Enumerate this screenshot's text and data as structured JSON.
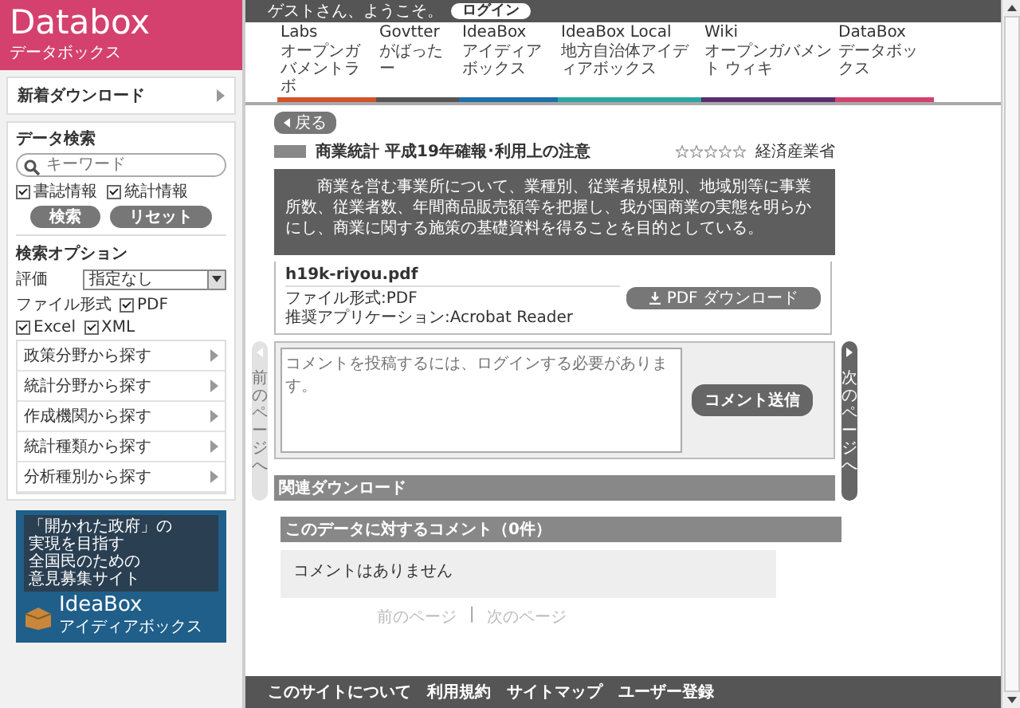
{
  "sidebar": {
    "logo": {
      "title": "Databox",
      "subtitle": "データボックス"
    },
    "new_downloads": "新着ダウンロード",
    "search": {
      "heading": "データ検索",
      "placeholder": "キーワード",
      "filters": [
        {
          "label": "書誌情報",
          "checked": true
        },
        {
          "label": "統計情報",
          "checked": true
        }
      ],
      "buttons": [
        "検索",
        "リセット"
      ]
    },
    "options": {
      "heading": "検索オプション",
      "rating_label": "評価",
      "rating_value": "指定なし",
      "format_label": "ファイル形式",
      "formats": [
        {
          "label": "PDF",
          "checked": true
        },
        {
          "label": "Excel",
          "checked": true
        },
        {
          "label": "XML",
          "checked": true
        }
      ]
    },
    "browse": [
      "政策分野から探す",
      "統計分野から探す",
      "作成機関から探す",
      "統計種類から探す",
      "分析種別から探す"
    ],
    "banner": {
      "lines": [
        "「開かれた政府」の",
        "実現を目指す",
        "全国民のための",
        "意見募集サイト"
      ],
      "logo": "IdeaBox",
      "logo_sub": "アイディアボックス"
    }
  },
  "top_bar": {
    "greeting": "ゲストさん、ようこそ。",
    "login": "ログイン"
  },
  "nav": [
    {
      "label": "Labs",
      "sub": "オープンガバメントラボ",
      "color": "#d0532c"
    },
    {
      "label": "Govtter",
      "sub": "がばったー",
      "color": "#555555"
    },
    {
      "label": "IdeaBox",
      "sub": "アイディアボックス",
      "color": "#1f6fa8"
    },
    {
      "label": "IdeaBox Local",
      "sub": "地方自治体アイディアボックス",
      "color": "#2aa7a0"
    },
    {
      "label": "Wiki",
      "sub": "オープンガバメント ウィキ",
      "color": "#5a2d6e"
    },
    {
      "label": "DataBox",
      "sub": "データボックス",
      "color": "#d4416f"
    }
  ],
  "back": "戻る",
  "record": {
    "title": "商業統計 平成19年確報･利用上の注意",
    "stars": 0,
    "publisher": "経済産業省",
    "description": "商業を営む事業所について、業種別、従業者規模別、地域別等に事業所数、従業者数、年間商品販売額等を把握し、我が国商業の実態を明らかにし、商業に関する施策の基礎資料を得ることを目的としている。",
    "file": {
      "name": "h19k-riyou.pdf",
      "format": "ファイル形式:PDF",
      "app": "推奨アプリケーション:Acrobat Reader",
      "download": "PDF ダウンロード"
    }
  },
  "pager_tabs": [
    {
      "label": "前のページへ",
      "disabled": true
    },
    {
      "label": "次のページへ",
      "disabled": false
    }
  ],
  "comment_form": {
    "placeholder": "コメントを投稿するには、ログインする必要があります。",
    "submit": "コメント送信"
  },
  "related": {
    "heading": "関連ダウンロード"
  },
  "comments": {
    "heading": "このデータに対するコメント（0件）",
    "empty": "コメントはありません"
  },
  "pagination": {
    "items": [
      {
        "label": "前のページ",
        "disabled": true
      },
      {
        "label": "次のページ",
        "disabled": true
      }
    ],
    "separator": "|"
  },
  "footer": [
    "このサイトについて",
    "利用規約",
    "サイトマップ",
    "ユーザー登録"
  ]
}
